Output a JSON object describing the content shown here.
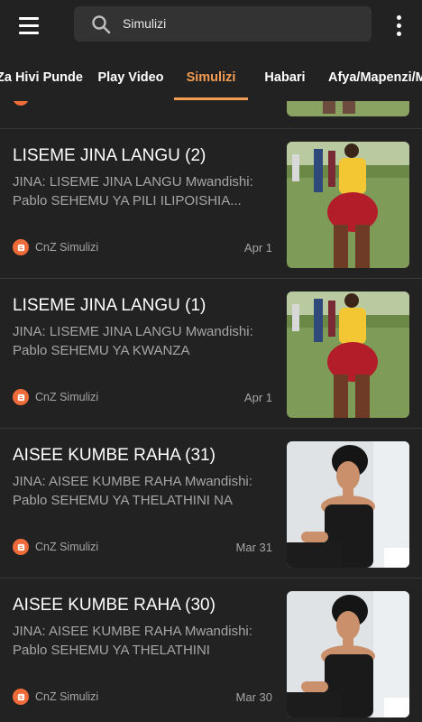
{
  "topbar": {
    "menu_icon": "hamburger-menu-icon",
    "search_icon": "search-icon",
    "search_value": "Simulizi",
    "more_icon": "more-vert-icon"
  },
  "tabs": [
    {
      "label": "Za Hivi Punde",
      "active": false
    },
    {
      "label": "Play Video",
      "active": false
    },
    {
      "label": "Simulizi",
      "active": true
    },
    {
      "label": "Habari",
      "active": false
    },
    {
      "label": "Afya/Mapenzi/M",
      "active": false
    }
  ],
  "colors": {
    "accent": "#f49c52",
    "background": "#222222",
    "blogger": "#ef6c3a"
  },
  "posts": [
    {
      "title": "LISEME JINA LANGU (2)",
      "snippet": "JINA: LISEME JINA LANGU Mwandishi: Pablo SEHEMU YA PILI ILIPOISHIA...",
      "source": "CnZ Simulizi",
      "date": "Apr 1",
      "source_icon": "blogger-icon"
    },
    {
      "title": "LISEME JINA LANGU (1)",
      "snippet": "JINA: LISEME JINA LANGU Mwandishi: Pablo SEHEMU YA KWANZA",
      "source": "CnZ Simulizi",
      "date": "Apr 1",
      "source_icon": "blogger-icon"
    },
    {
      "title": "AISEE KUMBE RAHA (31)",
      "snippet": "JINA: AISEE KUMBE RAHA Mwandishi: Pablo SEHEMU YA THELATHINI NA",
      "source": "CnZ Simulizi",
      "date": "Mar 31",
      "source_icon": "blogger-icon"
    },
    {
      "title": "AISEE KUMBE RAHA (30)",
      "snippet": "JINA: AISEE KUMBE RAHA Mwandishi: Pablo SEHEMU YA THELATHINI",
      "source": "CnZ Simulizi",
      "date": "Mar 30",
      "source_icon": "blogger-icon"
    }
  ]
}
